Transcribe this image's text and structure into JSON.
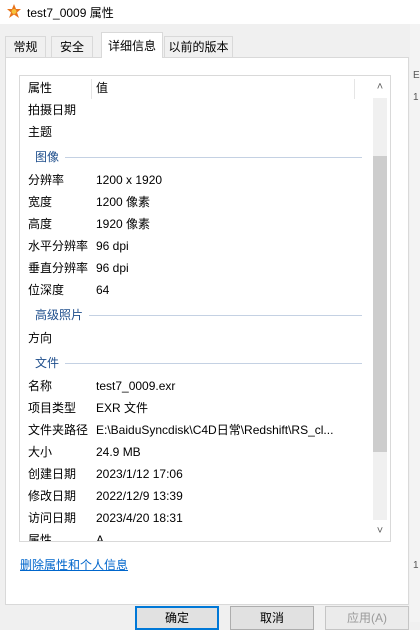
{
  "window": {
    "title": "test7_0009 属性"
  },
  "tabs": [
    {
      "label": "常规"
    },
    {
      "label": "安全"
    },
    {
      "label": "详细信息"
    },
    {
      "label": "以前的版本"
    }
  ],
  "details": {
    "header": {
      "property": "属性",
      "value": "值"
    },
    "rows_top": [
      {
        "property": "拍摄日期",
        "value": ""
      },
      {
        "property": "主题",
        "value": ""
      }
    ],
    "group_image": "图像",
    "image_rows": [
      {
        "property": "分辨率",
        "value": "1200 x 1920"
      },
      {
        "property": "宽度",
        "value": "1200 像素"
      },
      {
        "property": "高度",
        "value": "1920 像素"
      },
      {
        "property": "水平分辨率",
        "value": "96 dpi"
      },
      {
        "property": "垂直分辨率",
        "value": "96 dpi"
      },
      {
        "property": "位深度",
        "value": "64"
      }
    ],
    "group_advanced_photo": "高级照片",
    "advanced_rows": [
      {
        "property": "方向",
        "value": ""
      }
    ],
    "group_file": "文件",
    "file_rows": [
      {
        "property": "名称",
        "value": "test7_0009.exr"
      },
      {
        "property": "项目类型",
        "value": "EXR 文件"
      },
      {
        "property": "文件夹路径",
        "value": "E:\\BaiduSyncdisk\\C4D日常\\Redshift\\RS_cl..."
      },
      {
        "property": "大小",
        "value": "24.9 MB"
      },
      {
        "property": "创建日期",
        "value": "2023/1/12 17:06"
      },
      {
        "property": "修改日期",
        "value": "2022/12/9 13:39"
      },
      {
        "property": "访问日期",
        "value": "2023/4/20 18:31"
      },
      {
        "property": "属性",
        "value": "A"
      }
    ]
  },
  "remove_link": "删除属性和个人信息",
  "buttons": {
    "ok": "确定",
    "cancel": "取消",
    "apply": "应用(A)"
  },
  "right_strip": {
    "text1": "E",
    "text2": "1",
    "text3": "1"
  },
  "icons": {
    "app": "app-icon",
    "scroll_up": "chevron-up-icon",
    "scroll_down": "chevron-down-icon"
  }
}
